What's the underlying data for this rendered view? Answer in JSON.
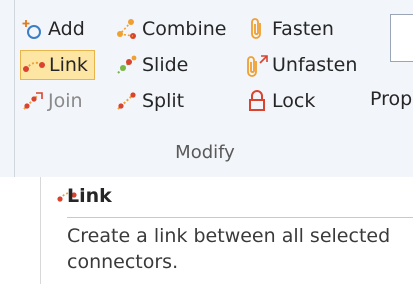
{
  "ribbon": {
    "group_label": "Modify",
    "buttons": {
      "add": "Add",
      "link": "Link",
      "join": "Join",
      "combine": "Combine",
      "slide": "Slide",
      "split": "Split",
      "fasten": "Fasten",
      "unfasten": "Unfasten",
      "lock": "Lock",
      "properties": "Prop"
    },
    "selected_button": "Link"
  },
  "tooltip": {
    "title": "Link",
    "description": "Create a link between all selected connectors."
  },
  "colors": {
    "ribbon_bg": "#f2f5f9",
    "selected_bg": "#fde6a3",
    "selected_border": "#e8b54a",
    "icon_red": "#d9432f",
    "icon_orange": "#f0a030",
    "icon_green": "#7ab648",
    "icon_blue": "#3b7ec8"
  }
}
